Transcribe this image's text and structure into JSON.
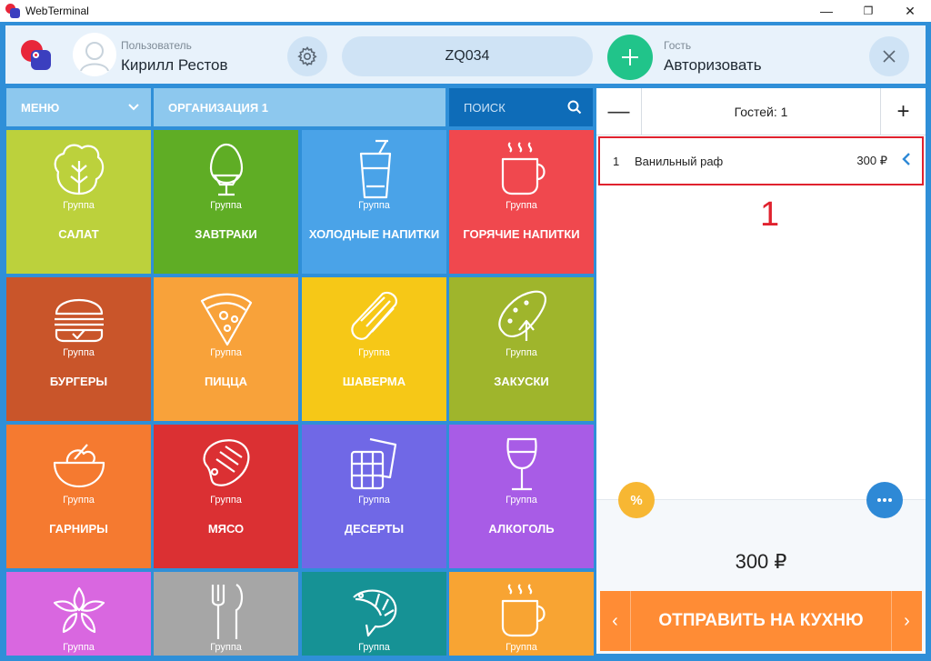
{
  "window": {
    "title": "WebTerminal",
    "minimize": "—",
    "maximize": "❐",
    "close": "✕"
  },
  "header": {
    "user_caption": "Пользователь",
    "user_name": "Кирилл Рестов",
    "table_code": "ZQ034",
    "guest_caption": "Гость",
    "guest_action": "Авторизовать"
  },
  "nav": {
    "menu": "МЕНЮ",
    "organization": "ОРГАНИЗАЦИЯ 1",
    "search": "ПОИСК"
  },
  "tiles": [
    {
      "group": "Группа",
      "name": "САЛАТ",
      "color": "#bcd13c",
      "icon": "lettuce-icon"
    },
    {
      "group": "Группа",
      "name": "ЗАВТРАКИ",
      "color": "#5fad25",
      "icon": "egg-icon"
    },
    {
      "group": "Группа",
      "name": "ХОЛОДНЫЕ НАПИТКИ",
      "color": "#4aa3e8",
      "icon": "cold-drink-icon"
    },
    {
      "group": "Группа",
      "name": "ГОРЯЧИЕ НАПИТКИ",
      "color": "#f0484e",
      "icon": "hot-cup-icon"
    },
    {
      "group": "Группа",
      "name": "БУРГЕРЫ",
      "color": "#c9552a",
      "icon": "burger-icon"
    },
    {
      "group": "Группа",
      "name": "ПИЦЦА",
      "color": "#f8a23a",
      "icon": "pizza-icon"
    },
    {
      "group": "Группа",
      "name": "ШАВЕРМА",
      "color": "#f6c817",
      "icon": "shawarma-icon"
    },
    {
      "group": "Группа",
      "name": "ЗАКУСКИ",
      "color": "#9fb52c",
      "icon": "pickle-icon"
    },
    {
      "group": "Группа",
      "name": "ГАРНИРЫ",
      "color": "#f57a30",
      "icon": "bowl-icon"
    },
    {
      "group": "Группа",
      "name": "МЯСО",
      "color": "#db3033",
      "icon": "steak-icon"
    },
    {
      "group": "Группа",
      "name": "ДЕСЕРТЫ",
      "color": "#7068e6",
      "icon": "waffle-icon"
    },
    {
      "group": "Группа",
      "name": "АЛКОГОЛЬ",
      "color": "#a85ce6",
      "icon": "wine-icon"
    },
    {
      "group": "Группа",
      "name": "",
      "color": "#d967e0",
      "icon": "flower-icon"
    },
    {
      "group": "Группа",
      "name": "",
      "color": "#a6a6a6",
      "icon": "cutlery-icon"
    },
    {
      "group": "Группа",
      "name": "",
      "color": "#169295",
      "icon": "shrimp-icon"
    },
    {
      "group": "Группа",
      "name": "",
      "color": "#f8a433",
      "icon": "hot-cup-icon"
    }
  ],
  "order": {
    "guests_label": "Гостей: 1",
    "minus": "—",
    "plus": "+",
    "items": [
      {
        "qty": "1",
        "name": "Ванильный раф",
        "price": "300 ₽"
      }
    ],
    "annotation": "1",
    "discount": "%",
    "total": "300 ₽",
    "send_label": "ОТПРАВИТЬ НА КУХНЮ",
    "prev": "‹",
    "next": "›"
  }
}
